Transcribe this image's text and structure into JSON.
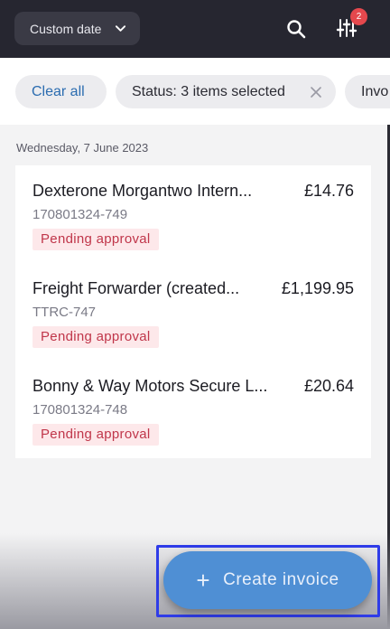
{
  "header": {
    "date_filter_label": "Custom date",
    "filter_badge_count": "2"
  },
  "filters": {
    "clear_label": "Clear all",
    "status_label": "Status: 3 items selected",
    "next_label": "Invo"
  },
  "list": {
    "date_heading": "Wednesday, 7 June 2023",
    "items": [
      {
        "name": "Dexterone Morgantwo Intern...",
        "amount": "£14.76",
        "ref": "170801324-749",
        "status": "Pending approval"
      },
      {
        "name": "Freight Forwarder (created...",
        "amount": "£1,199.95",
        "ref": "TTRC-747",
        "status": "Pending approval"
      },
      {
        "name": "Bonny & Way Motors Secure L...",
        "amount": "£20.64",
        "ref": "170801324-748",
        "status": "Pending approval"
      }
    ]
  },
  "cta": {
    "plus": "+",
    "label": "Create invoice"
  },
  "colors": {
    "topbar": "#262630",
    "accent": "#4f8fd4",
    "status_text": "#c0364a",
    "status_bg": "#fde8ea",
    "badge": "#e5484d"
  },
  "icons": [
    "chevron-down-icon",
    "search-icon",
    "filter-sliders-icon",
    "close-icon",
    "plus-icon"
  ]
}
